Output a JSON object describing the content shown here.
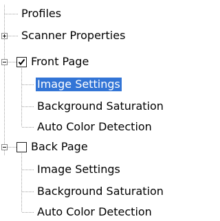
{
  "tree": {
    "items": [
      {
        "label": "Profiles"
      },
      {
        "label": "Scanner Properties",
        "expanded": false
      },
      {
        "label": "Front Page",
        "expanded": true,
        "checked": true
      },
      {
        "label": "Image Settings",
        "selected": true
      },
      {
        "label": "Background Saturation"
      },
      {
        "label": "Auto Color Detection"
      },
      {
        "label": "Back Page",
        "expanded": true,
        "checked": false
      },
      {
        "label": "Image Settings"
      },
      {
        "label": "Background Saturation"
      },
      {
        "label": "Auto Color Detection"
      }
    ]
  },
  "colors": {
    "selection": "#3375d6",
    "selection_text": "#ffffff",
    "connector": "#a0a0a0",
    "expander_border": "#888888"
  }
}
